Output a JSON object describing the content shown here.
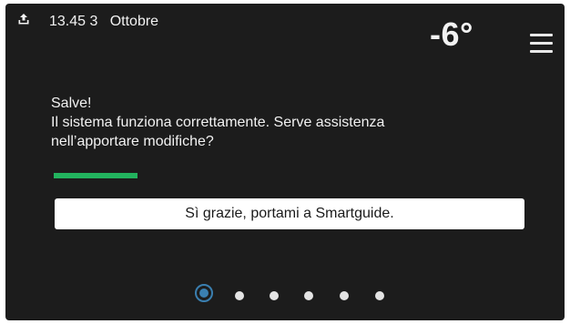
{
  "status_bar": {
    "icon": "upload-tray-icon",
    "datetime": "13.45 3   Ottobre",
    "temperature": "-6°",
    "menu_icon": "hamburger-menu-icon"
  },
  "message": {
    "greeting": "Salve!",
    "line1": "Il sistema funziona correttamente. Serve assistenza",
    "line2": "nell’apportare modifiche?"
  },
  "action_button": {
    "label": "Sì grazie, portami a Smartguide."
  },
  "pager": {
    "total_pages": 6,
    "active_page": 1
  },
  "colors": {
    "background": "#1c1c1c",
    "text": "#f2f2f2",
    "accent_green": "#22b35e",
    "active_dot": "#3a7fb0",
    "button_bg": "#ffffff"
  }
}
